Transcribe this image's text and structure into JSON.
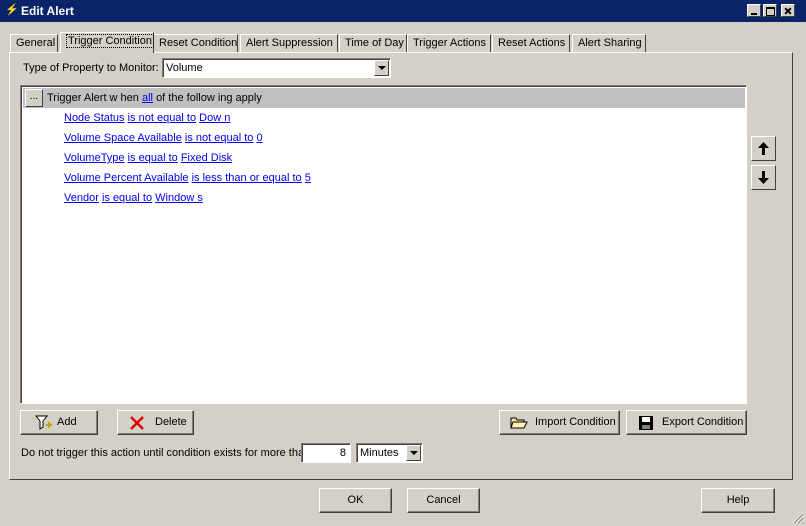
{
  "window": {
    "title": "Edit Alert"
  },
  "tabs": [
    {
      "label": "General"
    },
    {
      "label": "Trigger Condition"
    },
    {
      "label": "Reset Condition"
    },
    {
      "label": "Alert Suppression"
    },
    {
      "label": "Time of Day"
    },
    {
      "label": "Trigger Actions"
    },
    {
      "label": "Reset Actions"
    },
    {
      "label": "Alert Sharing"
    }
  ],
  "active_tab": "Trigger Condition",
  "property": {
    "label": "Type of Property to Monitor:",
    "value": "Volume"
  },
  "tree": {
    "ellipsis": "...",
    "header_pre": "Trigger Alert w hen",
    "header_link": "all",
    "header_post": "of the follow ing apply",
    "conditions": [
      {
        "field": "Node Status",
        "op": "is not equal to",
        "value": "Dow n"
      },
      {
        "field": "Volume Space Available",
        "op": "is not equal to",
        "value": "0"
      },
      {
        "field": "VolumeType",
        "op": "is equal to",
        "value": "Fixed Disk"
      },
      {
        "field": "Volume Percent Available",
        "op": "is less than or equal to",
        "value": "5"
      },
      {
        "field": "Vendor",
        "op": "is equal to",
        "value": "Window s"
      }
    ]
  },
  "buttons": {
    "add": "Add",
    "delete": "Delete",
    "import": "Import Condition",
    "export": "Export Condition",
    "ok": "OK",
    "cancel": "Cancel",
    "help": "Help"
  },
  "delay": {
    "label": "Do not trigger this action until condition exists for more than",
    "value": "8",
    "unit": "Minutes"
  },
  "icons": {
    "title": "app-icon",
    "add": "add-filter-icon",
    "delete": "red-x-icon",
    "import": "open-folder-icon",
    "export": "floppy-disk-icon",
    "up": "arrow-up-icon",
    "down": "arrow-down-icon"
  },
  "colors": {
    "titlebar": "#0a246a",
    "link": "#0000ee",
    "face": "#d4d0c8"
  }
}
